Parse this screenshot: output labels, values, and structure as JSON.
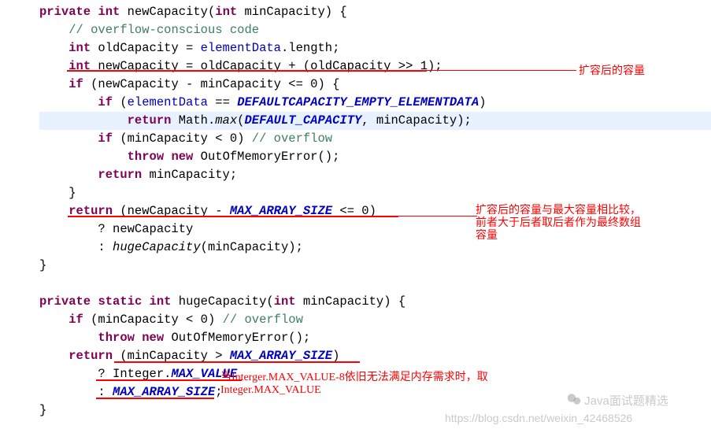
{
  "code": {
    "l1_kw_private": "private",
    "l1_kw_int": "int",
    "l1_name": "newCapacity(",
    "l1_kw_int2": "int",
    "l1_rest": " minCapacity) {",
    "l2_comment": "// overflow-conscious code",
    "l3_kw_int": "int",
    "l3_mid": " oldCapacity = ",
    "l3_field": "elementData",
    "l3_end": ".length;",
    "l4_kw_int": "int",
    "l4_rest": " newCapacity = oldCapacity + (oldCapacity >> 1);",
    "l5_kw_if": "if",
    "l5_rest": " (newCapacity - minCapacity <= 0) {",
    "l6_kw_if": "if",
    "l6_mid": " (",
    "l6_field": "elementData",
    "l6_eq": " == ",
    "l6_const": "DEFAULTCAPACITY_EMPTY_ELEMENTDATA",
    "l6_end": ")",
    "l7_kw_return": "return",
    "l7_mid": " Math.",
    "l7_max": "max",
    "l7_open": "(",
    "l7_const": "DEFAULT_CAPACITY",
    "l7_end": ", minCapacity);",
    "l8_kw_if": "if",
    "l8_mid": " (minCapacity < 0) ",
    "l8_comment": "// overflow",
    "l9_kw_throw": "throw",
    "l9_kw_new": "new",
    "l9_rest": " OutOfMemoryError();",
    "l10_kw_return": "return",
    "l10_rest": " minCapacity;",
    "l11": "}",
    "l12_kw_return": "return",
    "l12_mid": " (newCapacity - ",
    "l12_const": "MAX_ARRAY_SIZE",
    "l12_end": " <= 0)",
    "l13_mid": "? newCapacity",
    "l14_mid": ": ",
    "l14_method": "hugeCapacity",
    "l14_end": "(minCapacity);",
    "l15": "}",
    "l16_kw_private": "private",
    "l16_kw_static": "static",
    "l16_kw_int": "int",
    "l16_name": " hugeCapacity(",
    "l16_kw_int2": "int",
    "l16_rest": " minCapacity) {",
    "l17_kw_if": "if",
    "l17_mid": " (minCapacity < 0) ",
    "l17_comment": "// overflow",
    "l18_kw_throw": "throw",
    "l18_kw_new": "new",
    "l18_rest": " OutOfMemoryError();",
    "l19_kw_return": "return",
    "l19_mid": " (minCapacity > ",
    "l19_const": "MAX_ARRAY_SIZE",
    "l19_end": ")",
    "l20_mid": "? Integer.",
    "l20_const": "MAX_VALUE",
    "l21_mid": ": ",
    "l21_const": "MAX_ARRAY_SIZE",
    "l21_end": ";",
    "l22": "}"
  },
  "annotations": {
    "a1": "扩容后的容量",
    "a2_l1": "扩容后的容量与最大容量相比较，",
    "a2_l2": "前者大于后者取后者作为最终数组",
    "a2_l3": "容量",
    "a3_l1": "当Interger.MAX_VALUE-8依旧无法满足内存需求时，取",
    "a3_l2": "Integer.MAX_VALUE"
  },
  "watermark": {
    "title": "Java面试题精选",
    "url": "https://blog.csdn.net/weixin_42468526"
  }
}
